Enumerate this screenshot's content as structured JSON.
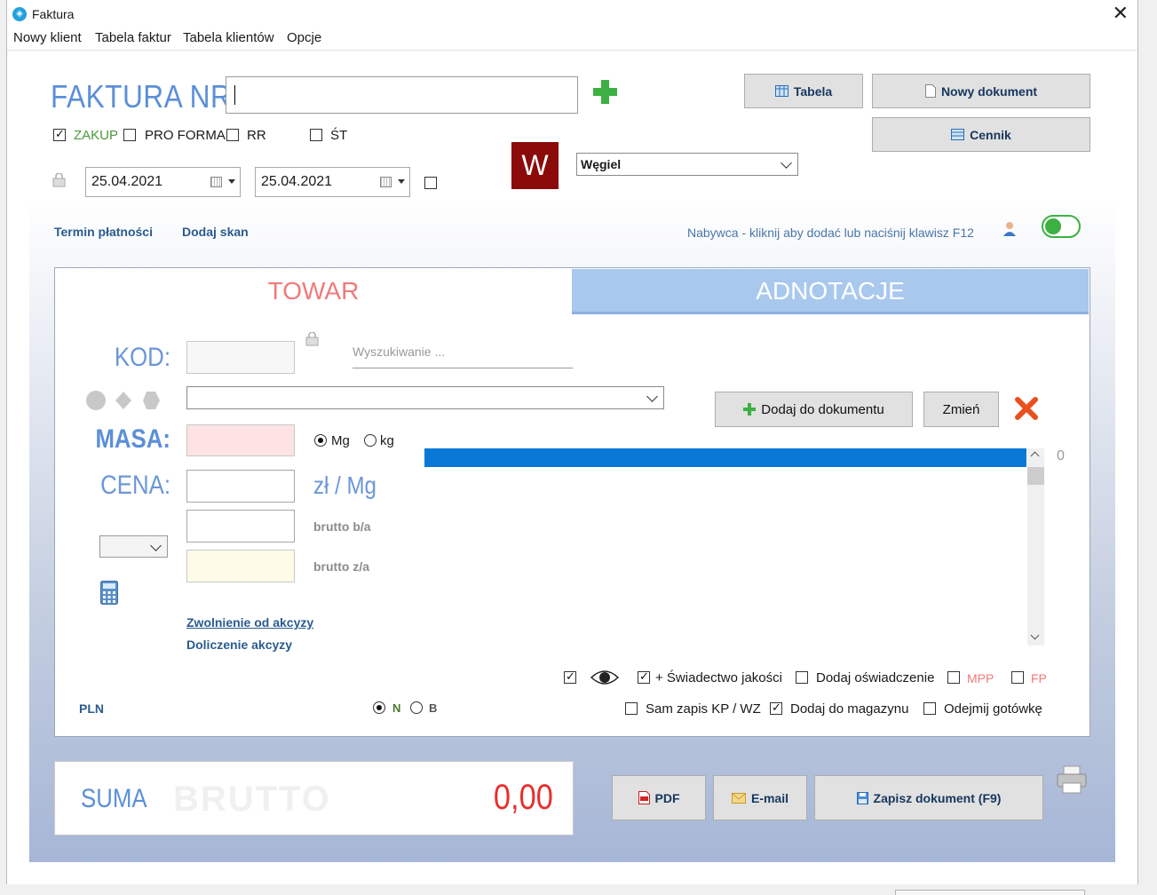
{
  "window": {
    "title": "Faktura"
  },
  "menu": [
    "Nowy klient",
    "Tabela faktur",
    "Tabela klientów",
    "Opcje"
  ],
  "header": {
    "title": "FAKTURA NR",
    "invoice_number": "",
    "btn_tabela": "Tabela",
    "btn_nowy_dokument": "Nowy dokument",
    "btn_cennik": "Cennik",
    "options": {
      "zakup": "ZAKUP",
      "pro_forma": "PRO FORMA",
      "rr": "RR",
      "st": "ŚT"
    },
    "date1": "25.04.2021",
    "date2": "25.04.2021",
    "w_badge": "W",
    "category_value": "Węgiel",
    "link_termin": "Termin płatności",
    "link_skan": "Dodaj skan",
    "buyer_prompt": "Nabywca - kliknij aby dodać lub naciśnij klawisz F12"
  },
  "tabs": {
    "towar": "TOWAR",
    "adnotacje": "ADNOTACJE"
  },
  "form": {
    "kod_label": "KOD:",
    "search_placeholder": "Wyszukiwanie ...",
    "masa_label": "MASA:",
    "unit_mg": "Mg",
    "unit_kg": "kg",
    "cena_label": "CENA:",
    "price_unit": "zł / Mg",
    "brutto_ba": "brutto b/a",
    "brutto_za": "brutto z/a",
    "link_zwolnienie": "Zwolnienie od akcyzy",
    "link_doliczenie": "Doliczenie akcyzy",
    "btn_dodaj": "Dodaj do dokumentu",
    "btn_zmien": "Zmień",
    "list_count": "0",
    "currency": "PLN",
    "radio_n": "N",
    "radio_b": "B",
    "chk_swiadectwo": "+ Świadectwo jakości",
    "chk_oswiadczenie": "Dodaj oświadczenie",
    "chk_mpp": "MPP",
    "chk_fp": "FP",
    "chk_kp_wz": "Sam zapis KP / WZ",
    "chk_magazyn": "Dodaj do magazynu",
    "chk_gotowka": "Odejmij gotówkę"
  },
  "footer": {
    "suma": "SUMA",
    "brutto": "BRUTTO",
    "total": "0,00",
    "btn_pdf": "PDF",
    "btn_email": "E-mail",
    "btn_zapisz": "Zapisz dokument (F9)"
  },
  "colors": {
    "accent_blue": "#5b8fd8",
    "tab_active_text": "#f07a7a",
    "tab_inactive_bg": "#a9c8ee",
    "progress_blue": "#0a78d7",
    "total_red": "#e63030",
    "w_badge_bg": "#8b0a0a",
    "toggle_green": "#3cb043"
  }
}
